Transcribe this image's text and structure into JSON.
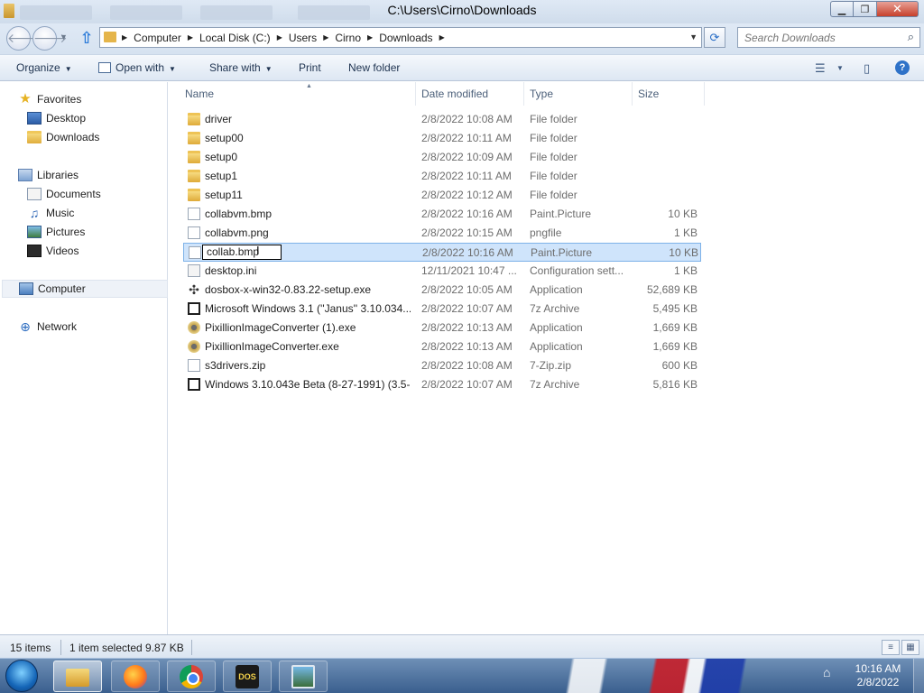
{
  "window": {
    "title": "C:\\Users\\Cirno\\Downloads"
  },
  "address": {
    "crumbs": [
      "Computer",
      "Local Disk (C:)",
      "Users",
      "Cirno",
      "Downloads"
    ],
    "search_placeholder": "Search Downloads"
  },
  "toolbar": {
    "organize": "Organize",
    "open_with": "Open with",
    "share_with": "Share with",
    "print": "Print",
    "new_folder": "New folder"
  },
  "nav": {
    "favorites": "Favorites",
    "desktop": "Desktop",
    "downloads": "Downloads",
    "libraries": "Libraries",
    "documents": "Documents",
    "music": "Music",
    "pictures": "Pictures",
    "videos": "Videos",
    "computer": "Computer",
    "network": "Network"
  },
  "columns": {
    "name": "Name",
    "date": "Date modified",
    "type": "Type",
    "size": "Size"
  },
  "files": [
    {
      "name": "driver",
      "date": "2/8/2022 10:08 AM",
      "type": "File folder",
      "size": "",
      "icon": "folder-icon"
    },
    {
      "name": "setup00",
      "date": "2/8/2022 10:11 AM",
      "type": "File folder",
      "size": "",
      "icon": "folder-icon"
    },
    {
      "name": "setup0",
      "date": "2/8/2022 10:09 AM",
      "type": "File folder",
      "size": "",
      "icon": "folder-icon"
    },
    {
      "name": "setup1",
      "date": "2/8/2022 10:11 AM",
      "type": "File folder",
      "size": "",
      "icon": "folder-icon"
    },
    {
      "name": "setup11",
      "date": "2/8/2022 10:12 AM",
      "type": "File folder",
      "size": "",
      "icon": "folder-icon"
    },
    {
      "name": "collabvm.bmp",
      "date": "2/8/2022 10:16 AM",
      "type": "Paint.Picture",
      "size": "10 KB",
      "icon": "file-icon"
    },
    {
      "name": "collabvm.png",
      "date": "2/8/2022 10:15 AM",
      "type": "pngfile",
      "size": "1 KB",
      "icon": "file-icon"
    },
    {
      "name": "collab.bmp",
      "date": "2/8/2022 10:16 AM",
      "type": "Paint.Picture",
      "size": "10 KB",
      "icon": "file-icon"
    },
    {
      "name": "desktop.ini",
      "date": "12/11/2021 10:47 ...",
      "type": "Configuration sett...",
      "size": "1 KB",
      "icon": "settings-file-icon"
    },
    {
      "name": "dosbox-x-win32-0.83.22-setup.exe",
      "date": "2/8/2022 10:05 AM",
      "type": "Application",
      "size": "52,689 KB",
      "icon": "dosbox-installer-icon"
    },
    {
      "name": "Microsoft Windows 3.1 (''Janus'' 3.10.034...",
      "date": "2/8/2022 10:07 AM",
      "type": "7z Archive",
      "size": "5,495 KB",
      "icon": "archive-7z-icon"
    },
    {
      "name": "PixillionImageConverter (1).exe",
      "date": "2/8/2022 10:13 AM",
      "type": "Application",
      "size": "1,669 KB",
      "icon": "application-icon"
    },
    {
      "name": "PixillionImageConverter.exe",
      "date": "2/8/2022 10:13 AM",
      "type": "Application",
      "size": "1,669 KB",
      "icon": "application-icon"
    },
    {
      "name": "s3drivers.zip",
      "date": "2/8/2022 10:08 AM",
      "type": "7-Zip.zip",
      "size": "600 KB",
      "icon": "file-icon"
    },
    {
      "name": "Windows 3.10.043e Beta (8-27-1991) (3.5-...",
      "date": "2/8/2022 10:07 AM",
      "type": "7z Archive",
      "size": "5,816 KB",
      "icon": "archive-7z-icon"
    }
  ],
  "status": {
    "count": "15 items",
    "selection": "1 item selected  9.87 KB"
  },
  "taskbar": {
    "time": "10:16 AM",
    "date": "2/8/2022",
    "dosbox_label": "DOS"
  },
  "colors": {
    "selection_bg": "#cfe4fb",
    "selection_border": "#7eb2e8",
    "taskbar": "#3a5f8e"
  }
}
